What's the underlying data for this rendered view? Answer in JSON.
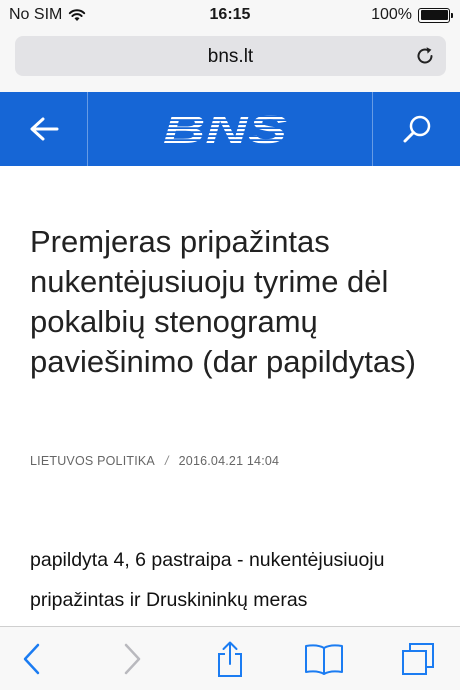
{
  "status_bar": {
    "carrier": "No SIM",
    "time": "16:15",
    "battery_percent": "100%",
    "battery_level": 1.0,
    "wifi_icon": "wifi-icon"
  },
  "browser": {
    "url": "bns.lt",
    "reload_icon": "reload-icon"
  },
  "site_header": {
    "background_color": "#1666d6",
    "back_icon": "arrow-left-icon",
    "logo_text": "BNS",
    "search_icon": "search-icon"
  },
  "article": {
    "title": "Premjeras pripažintas nukentėjusiuoju tyrime dėl pokalbių stenogramų paviešinimo (dar papildytas)",
    "category": "LIETUVOS POLITIKA",
    "separator": "/",
    "date": "2016.04.21 14:04",
    "body": "papildyta 4, 6 pastraipa - nukentėjusiuoju pripažintas ir Druskininkų meras"
  },
  "toolbar": {
    "back_icon": "chevron-left-icon",
    "forward_icon": "chevron-right-icon",
    "share_icon": "share-icon",
    "bookmarks_icon": "book-icon",
    "tabs_icon": "tabs-icon"
  }
}
